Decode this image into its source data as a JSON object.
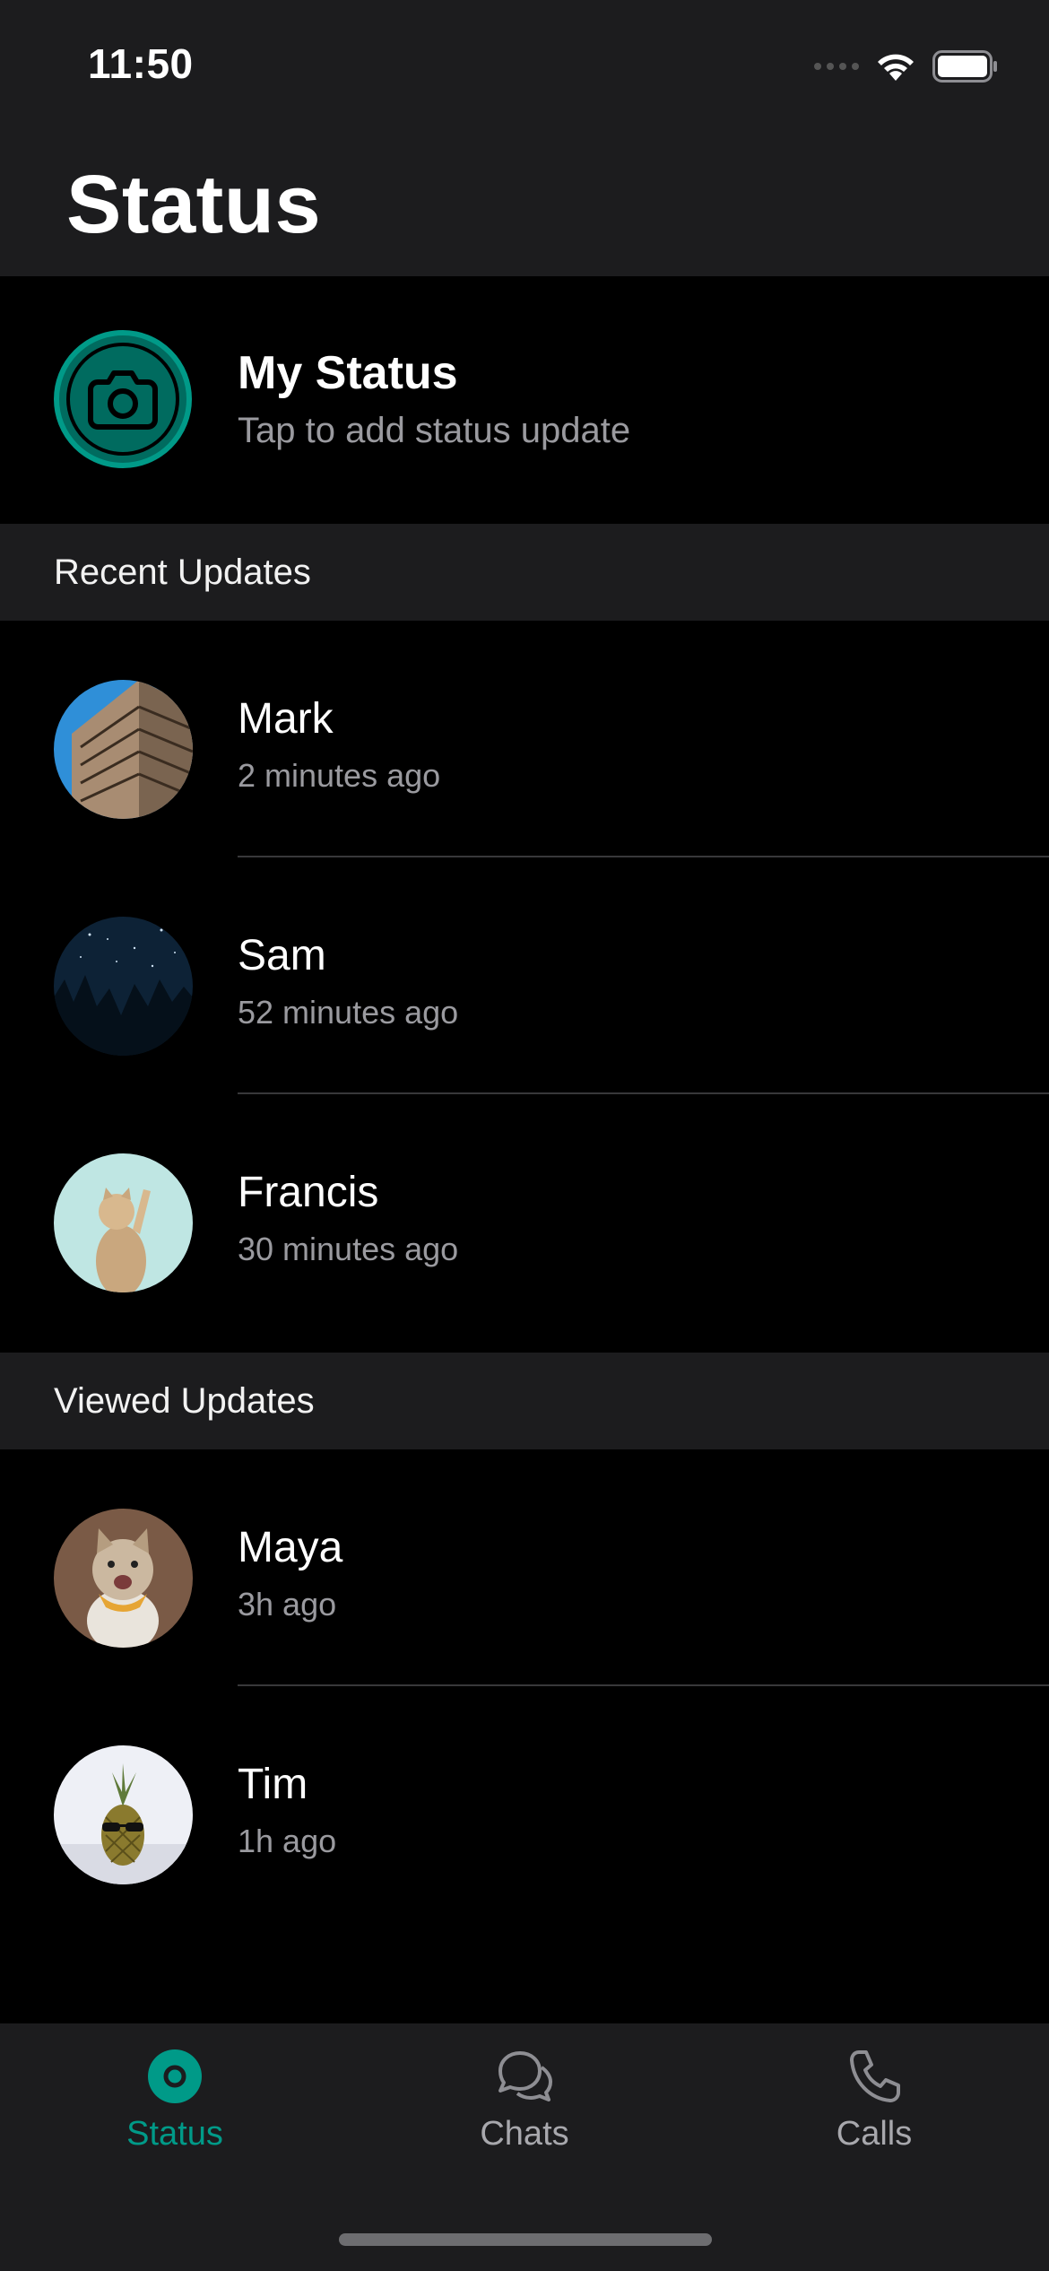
{
  "status_bar": {
    "time": "11:50"
  },
  "header": {
    "title": "Status"
  },
  "my_status": {
    "title": "My Status",
    "subtitle": "Tap to add status update"
  },
  "sections": {
    "recent": "Recent Updates",
    "viewed": "Viewed Updates"
  },
  "recent_updates": [
    {
      "name": "Mark",
      "time": "2 minutes ago",
      "avatar": "building"
    },
    {
      "name": "Sam",
      "time": "52 minutes ago",
      "avatar": "night-sky"
    },
    {
      "name": "Francis",
      "time": "30 minutes ago",
      "avatar": "cat"
    }
  ],
  "viewed_updates": [
    {
      "name": "Maya",
      "time": "3h ago",
      "avatar": "cat-bandana"
    },
    {
      "name": "Tim",
      "time": "1h ago",
      "avatar": "pineapple"
    }
  ],
  "tabs": [
    {
      "label": "Status",
      "icon": "status-icon",
      "active": true
    },
    {
      "label": "Chats",
      "icon": "chats-icon",
      "active": false
    },
    {
      "label": "Calls",
      "icon": "phone-icon",
      "active": false
    }
  ],
  "colors": {
    "accent": "#009a88",
    "background": "#000000",
    "surface": "#1c1c1e",
    "secondary_text": "#9a9a9f"
  }
}
